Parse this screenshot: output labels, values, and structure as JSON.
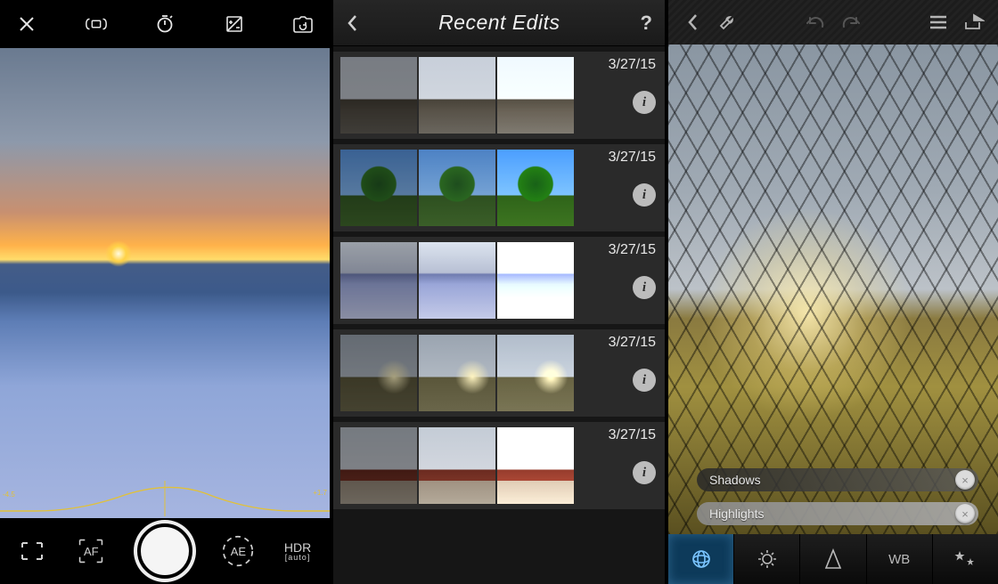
{
  "left": {
    "top_icons": {
      "close": "close-icon",
      "bracket_capture": "bracket-capture-icon",
      "timer": "timer-icon",
      "exposure_adjust": "exposure-adjust-icon",
      "switch_camera": "switch-camera-icon"
    },
    "histogram": {
      "left_label": "-4.5",
      "right_label": "+1.7"
    },
    "bottom": {
      "crop": "crop-icon",
      "af_label": "AF",
      "ae_label": "AE",
      "hdr_label": "HDR",
      "hdr_mode": "[auto]"
    }
  },
  "mid": {
    "title": "Recent Edits",
    "rows": [
      {
        "date": "3/27/15",
        "thumb_class": "t-street"
      },
      {
        "date": "3/27/15",
        "thumb_class": "t-palm"
      },
      {
        "date": "3/27/15",
        "thumb_class": "t-beach"
      },
      {
        "date": "3/27/15",
        "thumb_class": "t-field"
      },
      {
        "date": "3/27/15",
        "thumb_class": "t-barn"
      }
    ]
  },
  "right": {
    "top_icons": {
      "back": "back-icon",
      "tools": "tools-icon",
      "undo": "undo-icon",
      "redo": "redo-icon",
      "menu": "menu-icon",
      "share": "share-icon"
    },
    "sliders": {
      "shadows_label": "Shadows",
      "highlights_label": "Highlights"
    },
    "tabs": {
      "tone": "tone-tab",
      "exposure": "exposure-tab",
      "sharpen": "sharpen-tab",
      "wb_label": "WB",
      "effects": "effects-tab"
    }
  }
}
